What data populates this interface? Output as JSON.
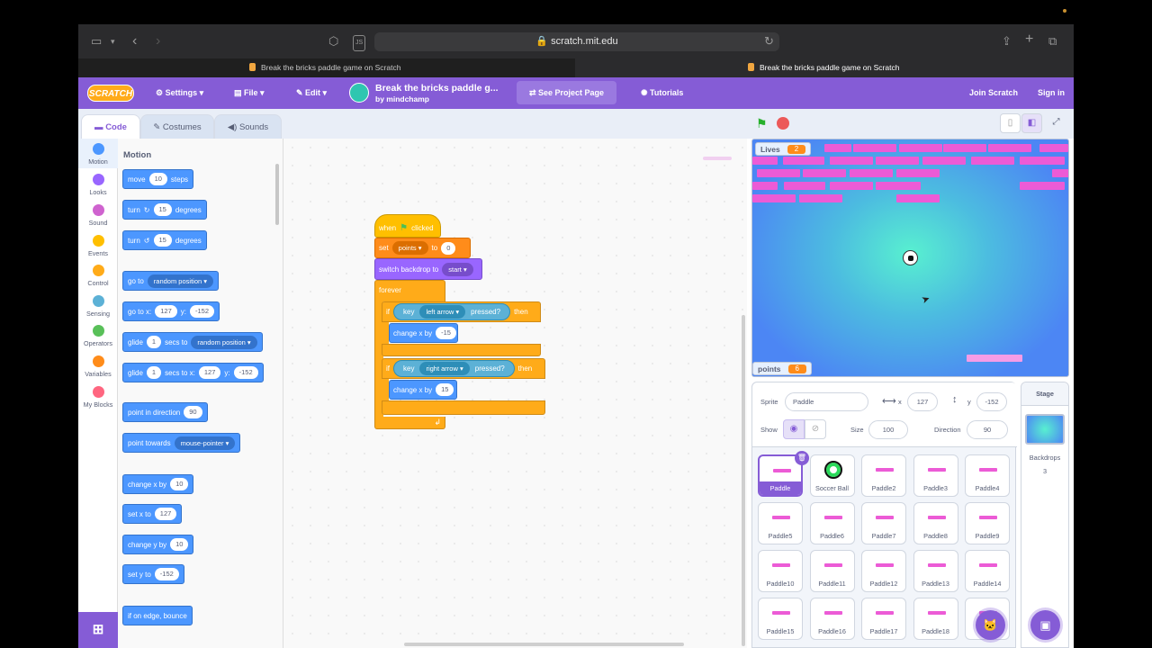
{
  "browser": {
    "url": "scratch.mit.edu",
    "tabs": [
      "Break the bricks paddle game on Scratch",
      "Break the bricks paddle game on Scratch"
    ]
  },
  "menu": {
    "logo": "SCRATCH",
    "settings": "Settings",
    "file": "File",
    "edit": "Edit",
    "project_title": "Break the bricks paddle g...",
    "project_by": "by mindchamp",
    "see_project": "See Project Page",
    "tutorials": "Tutorials",
    "join": "Join Scratch",
    "signin": "Sign in"
  },
  "editor_tabs": [
    "Code",
    "Costumes",
    "Sounds"
  ],
  "categories": [
    {
      "label": "Motion",
      "color": "#4c97ff"
    },
    {
      "label": "Looks",
      "color": "#9966ff"
    },
    {
      "label": "Sound",
      "color": "#cf63cf"
    },
    {
      "label": "Events",
      "color": "#ffbf00"
    },
    {
      "label": "Control",
      "color": "#ffab19"
    },
    {
      "label": "Sensing",
      "color": "#5cb1d6"
    },
    {
      "label": "Operators",
      "color": "#59c059"
    },
    {
      "label": "Variables",
      "color": "#ff8c1a"
    },
    {
      "label": "My Blocks",
      "color": "#ff6680"
    }
  ],
  "palette": {
    "heading": "Motion",
    "move": {
      "a": "move",
      "v": "10",
      "b": "steps"
    },
    "turn_r": {
      "a": "turn",
      "v": "15",
      "b": "degrees"
    },
    "turn_l": {
      "a": "turn",
      "v": "15",
      "b": "degrees"
    },
    "goto": {
      "a": "go to",
      "d": "random position"
    },
    "gotoxy": {
      "a": "go to x:",
      "x": "127",
      "y_lbl": "y:",
      "y": "-152"
    },
    "glide": {
      "a": "glide",
      "v": "1",
      "b": "secs to",
      "d": "random position"
    },
    "glidexy": {
      "a": "glide",
      "v": "1",
      "b": "secs to x:",
      "x": "127",
      "y_lbl": "y:",
      "y": "-152"
    },
    "pointdir": {
      "a": "point in direction",
      "v": "90"
    },
    "pointtow": {
      "a": "point towards",
      "d": "mouse-pointer"
    },
    "changex": {
      "a": "change x by",
      "v": "10"
    },
    "setx": {
      "a": "set x to",
      "v": "127"
    },
    "changey": {
      "a": "change y by",
      "v": "10"
    },
    "sety": {
      "a": "set y to",
      "v": "-152"
    },
    "bounce": {
      "a": "if on edge, bounce"
    }
  },
  "script": {
    "when": "when",
    "clicked": "clicked",
    "set": "set",
    "var": "points",
    "to": "to",
    "setval": "0",
    "switch": "switch backdrop to",
    "backdrop": "start",
    "forever": "forever",
    "if1": "if",
    "key1": "key",
    "key1val": "left arrow",
    "pressed1": "pressed?",
    "then1": "then",
    "change1": "change x by",
    "change1val": "-15",
    "if2": "if",
    "key2": "key",
    "key2val": "right arrow",
    "pressed2": "pressed?",
    "then2": "then",
    "change2": "change x by",
    "change2val": "15"
  },
  "stage": {
    "lives_label": "Lives",
    "lives_value": "2",
    "points_label": "points",
    "points_value": "6"
  },
  "sprite_info": {
    "sprite_label": "Sprite",
    "sprite_name": "Paddle",
    "x_label": "x",
    "x": "127",
    "y_label": "y",
    "y": "-152",
    "show_label": "Show",
    "size_label": "Size",
    "size": "100",
    "direction_label": "Direction",
    "direction": "90"
  },
  "sprites": [
    "Paddle",
    "Soccer Ball",
    "Paddle2",
    "Paddle3",
    "Paddle4",
    "Paddle5",
    "Paddle6",
    "Paddle7",
    "Paddle8",
    "Paddle9",
    "Paddle10",
    "Paddle11",
    "Paddle12",
    "Paddle13",
    "Paddle14",
    "Paddle15",
    "Paddle16",
    "Paddle17",
    "Paddle18",
    "P..."
  ],
  "stage_panel": {
    "title": "Stage",
    "backdrops_label": "Backdrops",
    "backdrops_count": "3"
  }
}
